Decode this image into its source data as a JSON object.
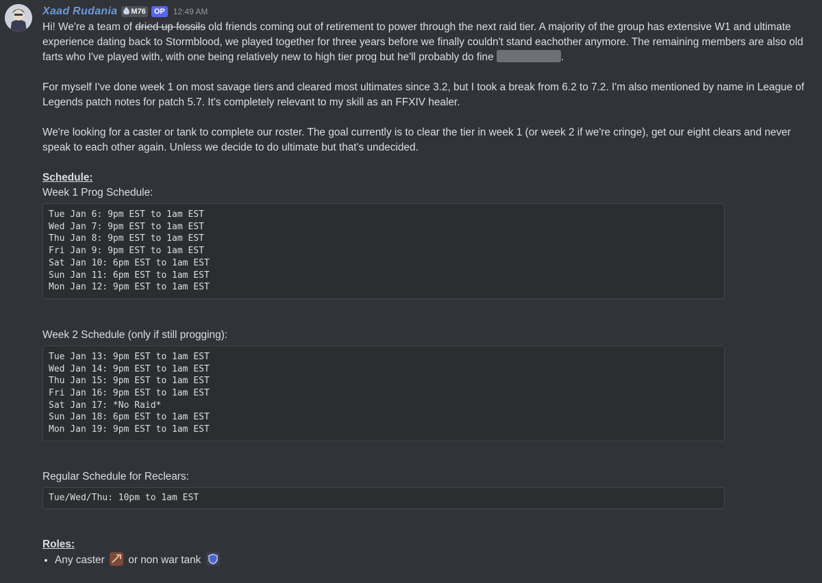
{
  "post": {
    "username": "Xaad Rudania",
    "tag_label": "M76",
    "op_label": "OP",
    "timestamp": "12:49 AM"
  },
  "body": {
    "p1_before": "Hi! We're a team of ",
    "p1_strike": "dried up fossils",
    "p1_after": " old friends coming out of retirement to power through the next raid tier. A majority of the group has extensive W1 and ultimate experience dating back to Stormblood, we played together for three years before we finally couldn't stand eachother anymore. The remaining members are also old farts who I've played with, with one being relatively new to high tier prog but he'll probably do fine ",
    "p1_end": ".",
    "p2": "For myself I've done week 1 on most savage tiers and cleared most ultimates since 3.2, but I took a break from 6.2 to 7.2. I'm also mentioned by name in League of Legends patch notes for patch 5.7. It's completely relevant to my skill as an FFXIV healer.",
    "p3": "We're looking for a caster or tank to complete our roster. The goal currently is to clear the tier in week 1 (or week 2 if we're cringe), get our eight clears and never speak to each other again. Unless we decide to do ultimate but that's undecided.",
    "schedule_heading": "Schedule:",
    "week1_label": "Week 1 Prog Schedule:",
    "week1_code": "Tue Jan 6: 9pm EST to 1am EST\nWed Jan 7: 9pm EST to 1am EST\nThu Jan 8: 9pm EST to 1am EST\nFri Jan 9: 9pm EST to 1am EST\nSat Jan 10: 6pm EST to 1am EST\nSun Jan 11: 6pm EST to 1am EST\nMon Jan 12: 9pm EST to 1am EST",
    "week2_label": "Week 2 Schedule (only if still progging):",
    "week2_code": "Tue Jan 13: 9pm EST to 1am EST\nWed Jan 14: 9pm EST to 1am EST\nThu Jan 15: 9pm EST to 1am EST\nFri Jan 16: 9pm EST to 1am EST\nSat Jan 17: *No Raid*\nSun Jan 18: 6pm EST to 1am EST\nMon Jan 19: 9pm EST to 1am EST",
    "regular_label": "Regular Schedule for Reclears:",
    "regular_code": "Tue/Wed/Thu: 10pm to 1am EST",
    "roles_heading": "Roles:",
    "roles_item_a": "Any caster",
    "roles_item_b": "or non war tank"
  },
  "icons": {
    "tag_icon": "water-drop-icon",
    "caster_icon": "caster-role-icon",
    "tank_icon": "tank-role-icon"
  }
}
